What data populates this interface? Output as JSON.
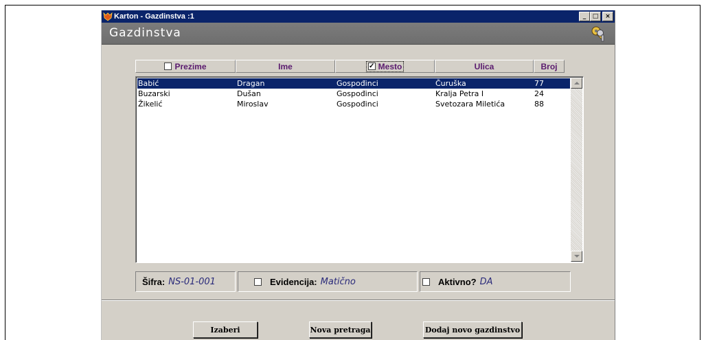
{
  "window": {
    "title": "Karton - Gazdinstva :1",
    "controls": {
      "minimize": "_",
      "maximize": "□",
      "close": "×"
    }
  },
  "header": {
    "title": "Gazdinstva",
    "icon": "keys-icon"
  },
  "columns": {
    "prezime": {
      "label": "Prezime",
      "checked": false
    },
    "ime": {
      "label": "Ime"
    },
    "mesto": {
      "label": "Mesto",
      "checked": true
    },
    "ulica": {
      "label": "Ulica"
    },
    "broj": {
      "label": "Broj"
    }
  },
  "rows": [
    {
      "prezime": "Babić",
      "ime": "Dragan",
      "mesto": "Gospođinci",
      "ulica": "Čuruška",
      "broj": "77",
      "selected": true
    },
    {
      "prezime": "Buzarski",
      "ime": "Dušan",
      "mesto": "Gospođinci",
      "ulica": "Kralja Petra I",
      "broj": "24",
      "selected": false
    },
    {
      "prezime": "Žikelić",
      "ime": "Miroslav",
      "mesto": "Gospođinci",
      "ulica": "Svetozara Miletića",
      "broj": "88",
      "selected": false
    }
  ],
  "info": {
    "sifra": {
      "label": "Šifra:",
      "value": "NS-01-001"
    },
    "evidencija": {
      "label": "Evidencija:",
      "value": "Matično",
      "checked": false
    },
    "aktivno": {
      "label": "Aktivno?",
      "value": "DA",
      "checked": false
    }
  },
  "buttons": {
    "izaberi": "Izaberi",
    "nova_pretraga": "Nova pretraga",
    "dodaj": "Dodaj novo gazdinstvo"
  },
  "colors": {
    "titlebar": "#0a246a",
    "selection": "#0a246a",
    "header_band": "#747474",
    "column_text": "#5a1a6e",
    "window_bg": "#d4d0c8"
  }
}
